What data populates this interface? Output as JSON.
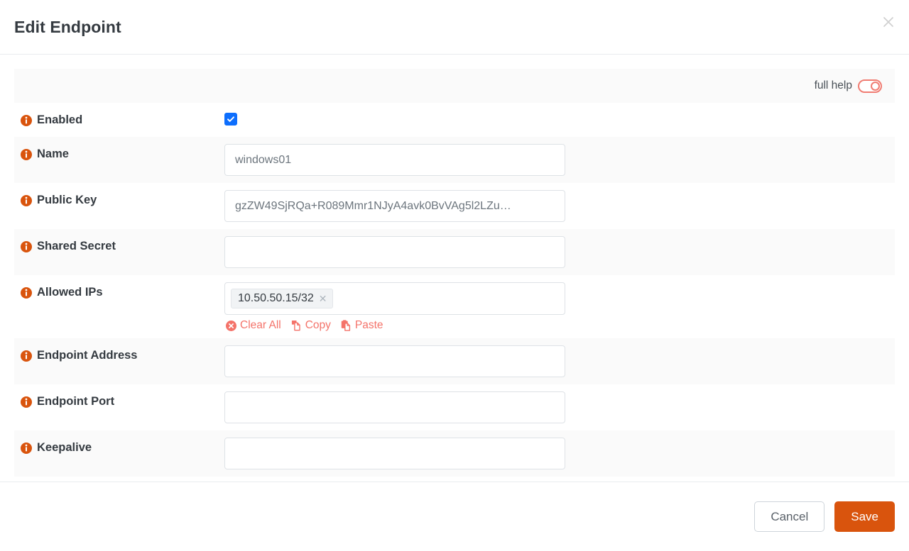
{
  "dialog": {
    "title": "Edit Endpoint",
    "close_icon": "close-icon"
  },
  "help": {
    "label": "full help",
    "toggle_state": "off",
    "accent_color": "#f07c72"
  },
  "colors": {
    "info_icon": "#d9540d",
    "checkbox": "#0d6efd",
    "save_button": "#d9540d",
    "link_red": "#f4736a",
    "stripe": "#fafafa"
  },
  "fields": [
    {
      "label": "Enabled",
      "type": "checkbox",
      "checked": true,
      "stripe": false
    },
    {
      "label": "Name",
      "type": "text",
      "value": "windows01",
      "placeholder": "",
      "stripe": true
    },
    {
      "label": "Public Key",
      "type": "text",
      "value": "gzZW49SjRQa+R089Mmr1NJyA4avk0BvVAg5l2LZu…",
      "placeholder": "",
      "stripe": false
    },
    {
      "label": "Shared Secret",
      "type": "text",
      "value": "",
      "placeholder": "",
      "stripe": true
    },
    {
      "label": "Allowed IPs",
      "type": "tokens",
      "tokens": [
        "10.50.50.15/32"
      ],
      "actions": [
        {
          "label": "Clear All",
          "icon": "clear-all-icon"
        },
        {
          "label": "Copy",
          "icon": "copy-icon"
        },
        {
          "label": "Paste",
          "icon": "paste-icon"
        }
      ],
      "stripe": false
    },
    {
      "label": "Endpoint Address",
      "type": "text",
      "value": "",
      "placeholder": "",
      "stripe": true
    },
    {
      "label": "Endpoint Port",
      "type": "text",
      "value": "",
      "placeholder": "",
      "stripe": false
    },
    {
      "label": "Keepalive",
      "type": "text",
      "value": "",
      "placeholder": "",
      "stripe": true
    }
  ],
  "footer": {
    "cancel_label": "Cancel",
    "save_label": "Save"
  }
}
